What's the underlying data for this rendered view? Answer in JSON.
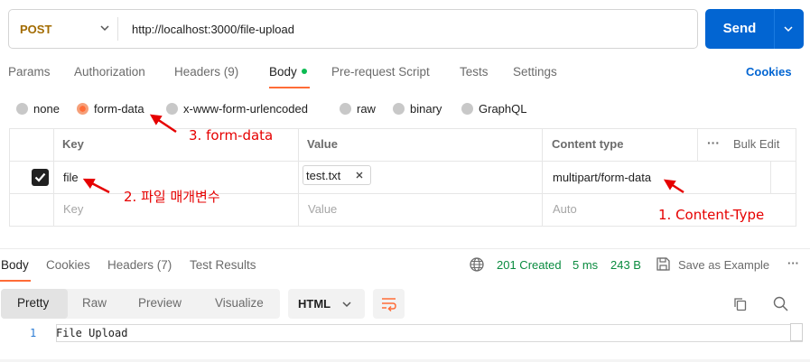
{
  "request": {
    "method": "POST",
    "url": "http://localhost:3000/file-upload",
    "send_label": "Send"
  },
  "request_tabs": [
    {
      "label": "Params"
    },
    {
      "label": "Authorization"
    },
    {
      "label": "Headers (9)"
    },
    {
      "label": "Body"
    },
    {
      "label": "Pre-request Script"
    },
    {
      "label": "Tests"
    },
    {
      "label": "Settings"
    }
  ],
  "cookies_link": "Cookies",
  "body_types": [
    {
      "label": "none"
    },
    {
      "label": "form-data"
    },
    {
      "label": "x-www-form-urlencoded"
    },
    {
      "label": "raw"
    },
    {
      "label": "binary"
    },
    {
      "label": "GraphQL"
    }
  ],
  "params_table": {
    "headers": {
      "key": "Key",
      "value": "Value",
      "content_type": "Content type"
    },
    "bulk_edit": "Bulk Edit",
    "more_icon": "···",
    "row": {
      "key": "file",
      "value": "test.txt",
      "content_type": "multipart/form-data"
    },
    "placeholders": {
      "key": "Key",
      "value": "Value",
      "content_type": "Auto"
    }
  },
  "annotations": {
    "a3": "3. form-data",
    "a2": "2. 파일 매개변수",
    "a1": "1. Content-Type"
  },
  "response": {
    "tabs": [
      {
        "label": "Body"
      },
      {
        "label": "Cookies"
      },
      {
        "label": "Headers (7)"
      },
      {
        "label": "Test Results"
      }
    ],
    "status": "201 Created",
    "time": "5 ms",
    "size": "243 B",
    "save_example": "Save as Example",
    "more_icon": "···",
    "view_tabs": [
      {
        "label": "Pretty"
      },
      {
        "label": "Raw"
      },
      {
        "label": "Preview"
      },
      {
        "label": "Visualize"
      }
    ],
    "language": "HTML",
    "line_number": "1",
    "code": "File Upload"
  },
  "colors": {
    "accent": "#ff6c37",
    "send": "#0265d2",
    "method": "#a26b00",
    "status_ok": "#0a8b3f",
    "annotation": "#e60000"
  }
}
